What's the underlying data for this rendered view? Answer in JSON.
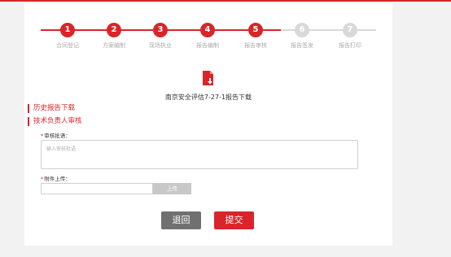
{
  "steps": [
    {
      "number": "1",
      "label": "合同登记",
      "state": "done"
    },
    {
      "number": "2",
      "label": "方案编制",
      "state": "done"
    },
    {
      "number": "3",
      "label": "现场执业",
      "state": "done"
    },
    {
      "number": "4",
      "label": "报告编制",
      "state": "done"
    },
    {
      "number": "5",
      "label": "报告审核",
      "state": "current"
    },
    {
      "number": "6",
      "label": "报告签发",
      "state": "pending"
    },
    {
      "number": "7",
      "label": "报告打印",
      "state": "pending"
    }
  ],
  "report": {
    "icon": "pdf-download-icon",
    "name": "南京安全评估7-27-1报告下载"
  },
  "sections": {
    "history": "历史报告下载",
    "review": "技术负责人审核"
  },
  "form": {
    "opinion_required": "*",
    "opinion_label": "审核批语：",
    "opinion_placeholder": "输入审核批语",
    "attachment_required": "*",
    "attachment_label": "附件上传：",
    "upload_label": "上传"
  },
  "actions": {
    "back_label": "退回",
    "submit_label": "提交"
  },
  "colors": {
    "accent": "#d9252a",
    "inactive": "#d9d9d9",
    "back_button": "#707070"
  }
}
